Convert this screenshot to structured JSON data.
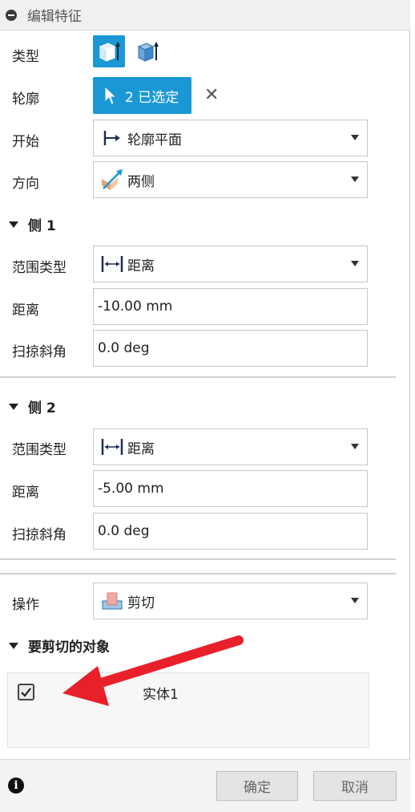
{
  "title": "编辑特征",
  "type": {
    "label": "类型",
    "options": [
      "实体",
      "曲面"
    ]
  },
  "profile": {
    "label": "轮廓",
    "selected": "2 已选定",
    "clear": "✕"
  },
  "start": {
    "label": "开始",
    "value": "轮廓平面"
  },
  "direction": {
    "label": "方向",
    "value": "两侧"
  },
  "side1": {
    "title": "侧 1",
    "extent_label": "范围类型",
    "extent_value": "距离",
    "distance_label": "距离",
    "distance_value": "-10.00 mm",
    "taper_label": "扫掠斜角",
    "taper_value": "0.0 deg"
  },
  "side2": {
    "title": "侧 2",
    "extent_label": "范围类型",
    "extent_value": "距离",
    "distance_label": "距离",
    "distance_value": "-5.00 mm",
    "taper_label": "扫掠斜角",
    "taper_value": "0.0 deg"
  },
  "operation": {
    "label": "操作",
    "value": "剪切"
  },
  "objects": {
    "title": "要剪切的对象",
    "items": [
      {
        "name": "实体1",
        "checked": true
      }
    ]
  },
  "footer": {
    "ok": "确定",
    "cancel": "取消"
  },
  "colors": {
    "accent": "#1a98d5",
    "annotation_arrow": "#e8202a"
  }
}
